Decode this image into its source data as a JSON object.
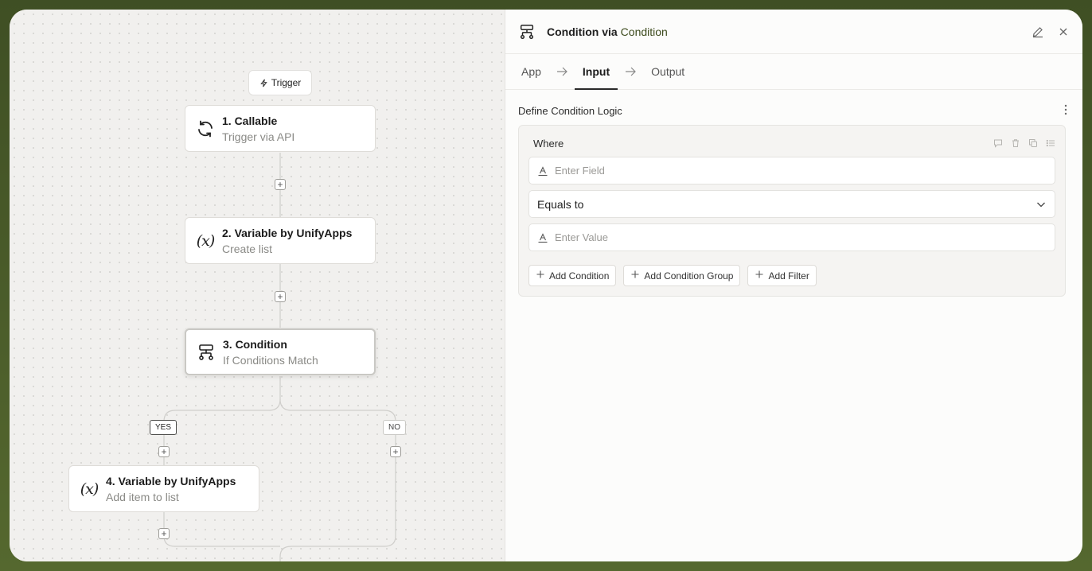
{
  "canvas": {
    "trigger_label": "Trigger",
    "nodes": [
      {
        "title": "1. Callable",
        "subtitle": "Trigger via API",
        "icon": "refresh-icon"
      },
      {
        "title": "2. Variable by UnifyApps",
        "subtitle": "Create list",
        "icon": "variable-icon"
      },
      {
        "title": "3. Condition",
        "subtitle": "If Conditions Match",
        "icon": "condition-icon"
      },
      {
        "title": "4. Variable by UnifyApps",
        "subtitle": "Add item to list",
        "icon": "variable-icon"
      }
    ],
    "branch_yes": "YES",
    "branch_no": "NO",
    "variable_glyph": "(x)",
    "plus": "+"
  },
  "panel": {
    "title": "Condition via",
    "title_app": "Condition",
    "tabs": [
      {
        "label": "App",
        "active": false
      },
      {
        "label": "Input",
        "active": true
      },
      {
        "label": "Output",
        "active": false
      }
    ],
    "section_title": "Define Condition Logic",
    "condition": {
      "where_label": "Where",
      "field_placeholder": "Enter Field",
      "operator": "Equals to",
      "value_placeholder": "Enter Value"
    },
    "buttons": {
      "add_condition": "Add Condition",
      "add_condition_group": "Add Condition Group",
      "add_filter": "Add Filter"
    }
  },
  "colors": {
    "background": "#4a5a2c",
    "canvas": "#f1f0ee",
    "panel": "#fcfcfb",
    "accent_text": "#3c4a1c"
  }
}
